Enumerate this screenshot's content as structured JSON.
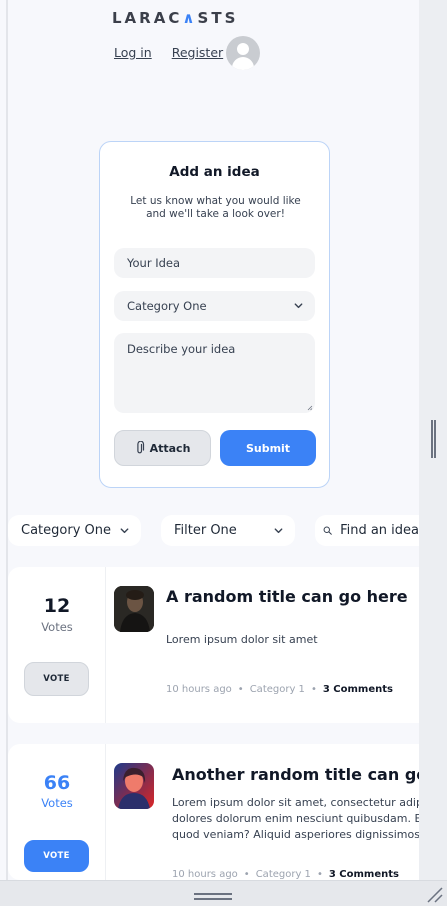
{
  "header": {
    "logo_left": "LARAC",
    "logo_accent": "∧",
    "logo_right": "STS",
    "login_label": "Log in",
    "register_label": "Register"
  },
  "idea_form": {
    "title": "Add an idea",
    "description": "Let us know what you would like and we'll take a look over!",
    "title_placeholder": "Your Idea",
    "category_value": "Category One",
    "description_placeholder": "Describe your idea",
    "attach_label": "Attach",
    "submit_label": "Submit"
  },
  "filters": {
    "category": "Category One",
    "filter": "Filter One",
    "search_placeholder": "Find an idea"
  },
  "ideas": [
    {
      "votes": "12",
      "votes_label": "Votes",
      "vote_button": "VOTE",
      "title": "A random title can go here",
      "body": "Lorem ipsum dolor sit amet",
      "time": "10 hours ago",
      "category": "Category 1",
      "comments": "3 Comments",
      "voted": false
    },
    {
      "votes": "66",
      "votes_label": "Votes",
      "vote_button": "VOTE",
      "title": "Another random title can go here",
      "body_lines": [
        "Lorem ipsum dolor sit amet, consectetur adipi",
        "dolores dolorum enim nesciunt quibusdam. E",
        "quod veniam? Aliquid asperiores dignissimos"
      ],
      "time": "10 hours ago",
      "category": "Category 1",
      "comments": "3 Comments",
      "voted": true
    }
  ],
  "colors": {
    "accent": "#3b82f6",
    "background": "#f7f8fc"
  },
  "icons": [
    "chevron-down-icon",
    "paperclip-icon",
    "search-icon",
    "user-placeholder-icon"
  ]
}
